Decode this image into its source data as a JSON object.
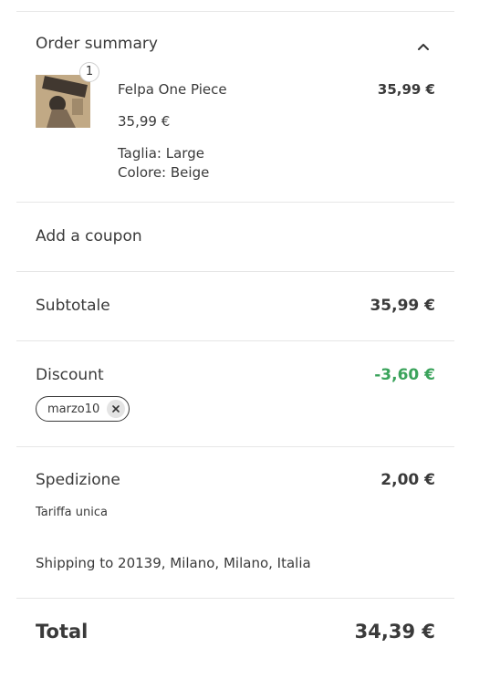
{
  "summary": {
    "title": "Order summary",
    "toggle_icon": "chevron-up-icon"
  },
  "item": {
    "quantity": "1",
    "name": "Felpa One Piece",
    "line_total": "35,99 €",
    "unit_price": "35,99 €",
    "size": "Taglia: Large",
    "color": "Colore: Beige",
    "thumbnail": "product-thumbnail"
  },
  "coupon": {
    "label": "Add a coupon"
  },
  "subtotal": {
    "label": "Subtotale",
    "value": "35,99 €"
  },
  "discount": {
    "label": "Discount",
    "value": "-3,60 €",
    "color": "#3aa35b",
    "code": "marzo10",
    "remove_icon": "close-icon"
  },
  "shipping": {
    "label": "Spedizione",
    "value": "2,00 €",
    "method": "Tariffa unica",
    "destination": "Shipping to 20139, Milano, Milano, Italia"
  },
  "total": {
    "label": "Total",
    "value": "34,39 €"
  }
}
